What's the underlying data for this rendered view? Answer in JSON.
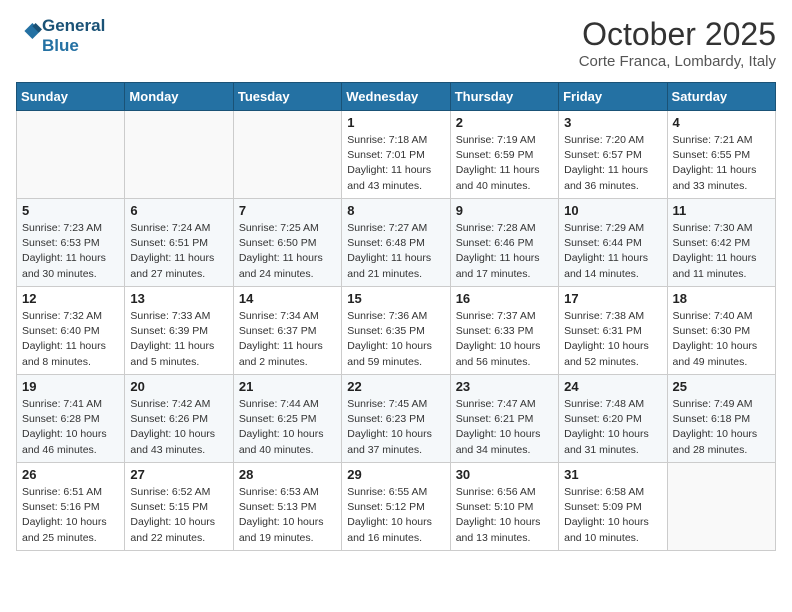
{
  "logo": {
    "line1": "General",
    "line2": "Blue"
  },
  "title": "October 2025",
  "location": "Corte Franca, Lombardy, Italy",
  "days_of_week": [
    "Sunday",
    "Monday",
    "Tuesday",
    "Wednesday",
    "Thursday",
    "Friday",
    "Saturday"
  ],
  "weeks": [
    [
      {
        "day": "",
        "info": ""
      },
      {
        "day": "",
        "info": ""
      },
      {
        "day": "",
        "info": ""
      },
      {
        "day": "1",
        "info": "Sunrise: 7:18 AM\nSunset: 7:01 PM\nDaylight: 11 hours\nand 43 minutes."
      },
      {
        "day": "2",
        "info": "Sunrise: 7:19 AM\nSunset: 6:59 PM\nDaylight: 11 hours\nand 40 minutes."
      },
      {
        "day": "3",
        "info": "Sunrise: 7:20 AM\nSunset: 6:57 PM\nDaylight: 11 hours\nand 36 minutes."
      },
      {
        "day": "4",
        "info": "Sunrise: 7:21 AM\nSunset: 6:55 PM\nDaylight: 11 hours\nand 33 minutes."
      }
    ],
    [
      {
        "day": "5",
        "info": "Sunrise: 7:23 AM\nSunset: 6:53 PM\nDaylight: 11 hours\nand 30 minutes."
      },
      {
        "day": "6",
        "info": "Sunrise: 7:24 AM\nSunset: 6:51 PM\nDaylight: 11 hours\nand 27 minutes."
      },
      {
        "day": "7",
        "info": "Sunrise: 7:25 AM\nSunset: 6:50 PM\nDaylight: 11 hours\nand 24 minutes."
      },
      {
        "day": "8",
        "info": "Sunrise: 7:27 AM\nSunset: 6:48 PM\nDaylight: 11 hours\nand 21 minutes."
      },
      {
        "day": "9",
        "info": "Sunrise: 7:28 AM\nSunset: 6:46 PM\nDaylight: 11 hours\nand 17 minutes."
      },
      {
        "day": "10",
        "info": "Sunrise: 7:29 AM\nSunset: 6:44 PM\nDaylight: 11 hours\nand 14 minutes."
      },
      {
        "day": "11",
        "info": "Sunrise: 7:30 AM\nSunset: 6:42 PM\nDaylight: 11 hours\nand 11 minutes."
      }
    ],
    [
      {
        "day": "12",
        "info": "Sunrise: 7:32 AM\nSunset: 6:40 PM\nDaylight: 11 hours\nand 8 minutes."
      },
      {
        "day": "13",
        "info": "Sunrise: 7:33 AM\nSunset: 6:39 PM\nDaylight: 11 hours\nand 5 minutes."
      },
      {
        "day": "14",
        "info": "Sunrise: 7:34 AM\nSunset: 6:37 PM\nDaylight: 11 hours\nand 2 minutes."
      },
      {
        "day": "15",
        "info": "Sunrise: 7:36 AM\nSunset: 6:35 PM\nDaylight: 10 hours\nand 59 minutes."
      },
      {
        "day": "16",
        "info": "Sunrise: 7:37 AM\nSunset: 6:33 PM\nDaylight: 10 hours\nand 56 minutes."
      },
      {
        "day": "17",
        "info": "Sunrise: 7:38 AM\nSunset: 6:31 PM\nDaylight: 10 hours\nand 52 minutes."
      },
      {
        "day": "18",
        "info": "Sunrise: 7:40 AM\nSunset: 6:30 PM\nDaylight: 10 hours\nand 49 minutes."
      }
    ],
    [
      {
        "day": "19",
        "info": "Sunrise: 7:41 AM\nSunset: 6:28 PM\nDaylight: 10 hours\nand 46 minutes."
      },
      {
        "day": "20",
        "info": "Sunrise: 7:42 AM\nSunset: 6:26 PM\nDaylight: 10 hours\nand 43 minutes."
      },
      {
        "day": "21",
        "info": "Sunrise: 7:44 AM\nSunset: 6:25 PM\nDaylight: 10 hours\nand 40 minutes."
      },
      {
        "day": "22",
        "info": "Sunrise: 7:45 AM\nSunset: 6:23 PM\nDaylight: 10 hours\nand 37 minutes."
      },
      {
        "day": "23",
        "info": "Sunrise: 7:47 AM\nSunset: 6:21 PM\nDaylight: 10 hours\nand 34 minutes."
      },
      {
        "day": "24",
        "info": "Sunrise: 7:48 AM\nSunset: 6:20 PM\nDaylight: 10 hours\nand 31 minutes."
      },
      {
        "day": "25",
        "info": "Sunrise: 7:49 AM\nSunset: 6:18 PM\nDaylight: 10 hours\nand 28 minutes."
      }
    ],
    [
      {
        "day": "26",
        "info": "Sunrise: 6:51 AM\nSunset: 5:16 PM\nDaylight: 10 hours\nand 25 minutes."
      },
      {
        "day": "27",
        "info": "Sunrise: 6:52 AM\nSunset: 5:15 PM\nDaylight: 10 hours\nand 22 minutes."
      },
      {
        "day": "28",
        "info": "Sunrise: 6:53 AM\nSunset: 5:13 PM\nDaylight: 10 hours\nand 19 minutes."
      },
      {
        "day": "29",
        "info": "Sunrise: 6:55 AM\nSunset: 5:12 PM\nDaylight: 10 hours\nand 16 minutes."
      },
      {
        "day": "30",
        "info": "Sunrise: 6:56 AM\nSunset: 5:10 PM\nDaylight: 10 hours\nand 13 minutes."
      },
      {
        "day": "31",
        "info": "Sunrise: 6:58 AM\nSunset: 5:09 PM\nDaylight: 10 hours\nand 10 minutes."
      },
      {
        "day": "",
        "info": ""
      }
    ]
  ]
}
